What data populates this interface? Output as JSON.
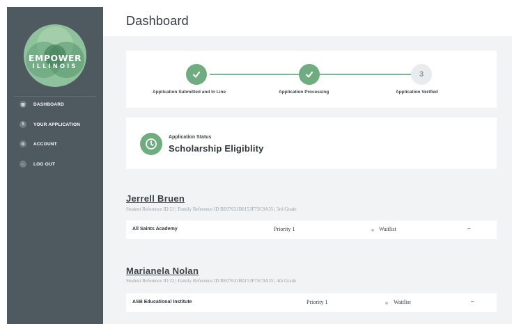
{
  "logo": {
    "line1": "EMPOWER",
    "line2": "ILLINOIS"
  },
  "sidebar": {
    "items": [
      {
        "label": "DASHBOARD",
        "icon": "grid-icon",
        "glyph": "▦"
      },
      {
        "label": "YOUR APPLICATION",
        "icon": "dollar-icon",
        "glyph": "$"
      },
      {
        "label": "ACCOUNT",
        "icon": "gear-icon",
        "glyph": "✲"
      },
      {
        "label": "LOG OUT",
        "icon": "arrow-left-icon",
        "glyph": "←"
      }
    ]
  },
  "header": {
    "title": "Dashboard"
  },
  "progress": {
    "steps": [
      {
        "label": "Application Submitted and In Line",
        "status": "done"
      },
      {
        "label": "Application Processing",
        "status": "done"
      },
      {
        "label": "Application Verified",
        "status": "todo",
        "number": "3"
      }
    ]
  },
  "status": {
    "small_label": "Application Status",
    "value": "Scholarship Eligiblity"
  },
  "students": [
    {
      "name": "Jerrell Bruen",
      "meta": "Student Reference ID 21 | Family Reference ID BE07631B0153F75C9A35 | 3rd Grade",
      "school": "All Saints Academy",
      "priority": "Priority 1",
      "status": "Waitlist",
      "extra": "–"
    },
    {
      "name": "Marianela Nolan",
      "meta": "Student Reference ID 22 | Family Reference ID BE07631B0153F75C9A35 | 4th Grade",
      "school": "ASB Educational Institute",
      "priority": "Priority 1",
      "status": "Waitlist",
      "extra": "–"
    }
  ],
  "colors": {
    "sidebar": "#4f5960",
    "accent_green": "#6fac80",
    "background": "#f1f3f5"
  }
}
